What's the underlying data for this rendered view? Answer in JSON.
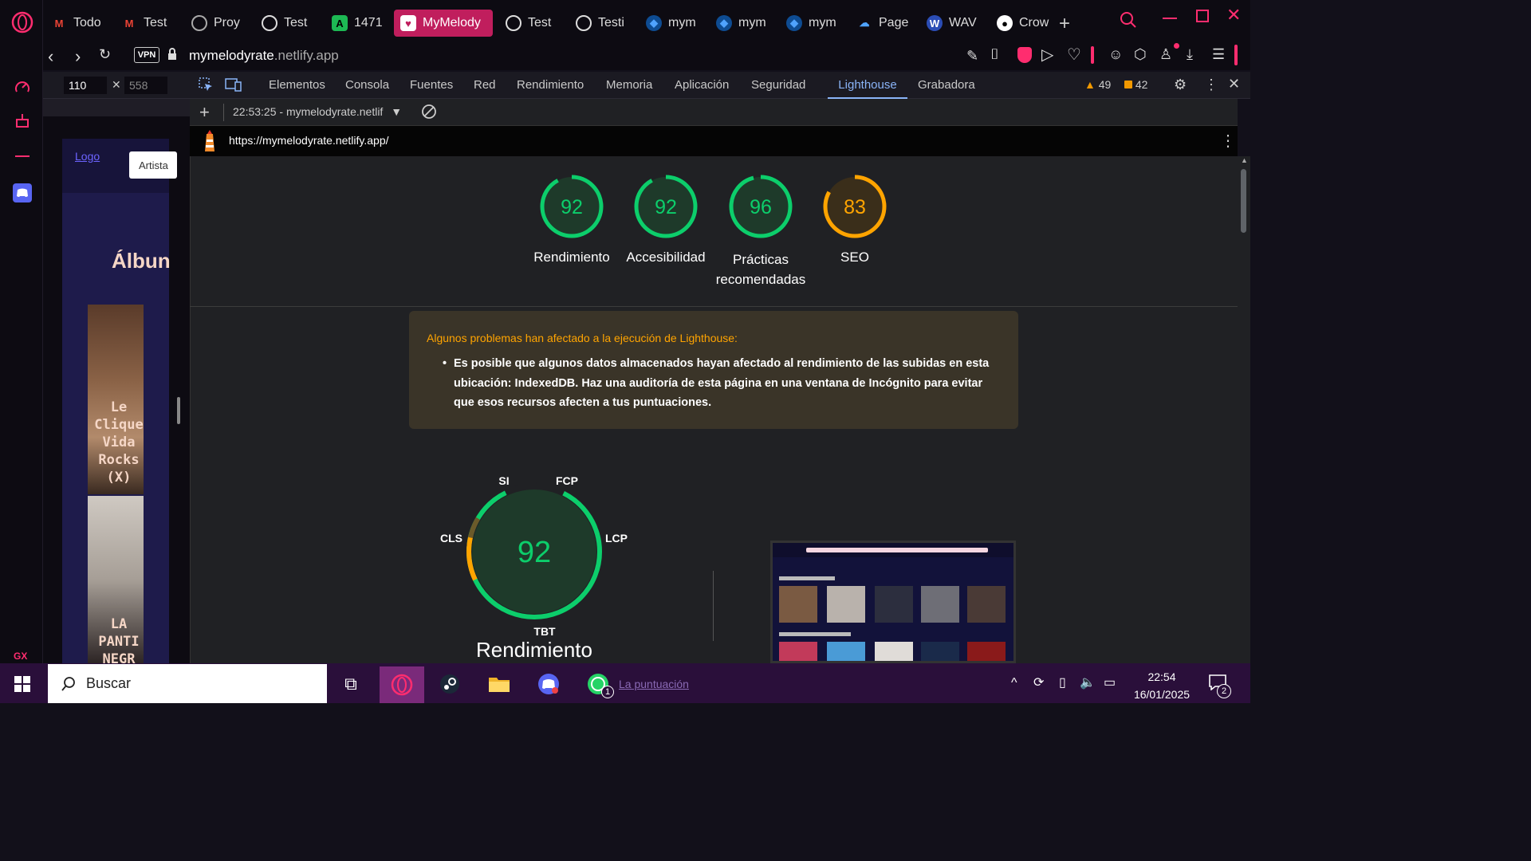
{
  "tabs": [
    {
      "label": "Todo",
      "icon": "gmail-icon"
    },
    {
      "label": "Test",
      "icon": "gmail-icon"
    },
    {
      "label": "Proy",
      "icon": "openai-icon"
    },
    {
      "label": "Test",
      "icon": "chatgpt-icon"
    },
    {
      "label": "1471",
      "icon": "a-icon"
    },
    {
      "label": "MyMelody",
      "icon": "mymelody-icon",
      "active": true
    },
    {
      "label": "Test",
      "icon": "chatgpt-icon"
    },
    {
      "label": "Testi",
      "icon": "openai-icon"
    },
    {
      "label": "mym",
      "icon": "netlify-icon"
    },
    {
      "label": "mym",
      "icon": "netlify-icon"
    },
    {
      "label": "mym",
      "icon": "netlify-icon"
    },
    {
      "label": "Page",
      "icon": "pages-icon"
    },
    {
      "label": "WAV",
      "icon": "wave-icon"
    },
    {
      "label": "Crow",
      "icon": "github-icon"
    }
  ],
  "address": {
    "vpn": "VPN",
    "url_host": "mymelodyrate",
    "url_rest": ".netlify.app"
  },
  "device": {
    "width": "110",
    "height": "558"
  },
  "devtools": {
    "tabs": [
      "Elementos",
      "Consola",
      "Fuentes",
      "Red",
      "Rendimiento",
      "Memoria",
      "Aplicación",
      "Seguridad",
      "Lighthouse",
      "Grabadora"
    ],
    "active_tab": "Lighthouse",
    "warnings": "49",
    "errors": "42"
  },
  "lighthouse": {
    "report_selector": "22:53:25 - mymelodyrate.netlif",
    "url": "https://mymelodyrate.netlify.app/",
    "scores": [
      {
        "value": "92",
        "label": "Rendimiento",
        "color": "#0cce6b"
      },
      {
        "value": "92",
        "label": "Accesibilidad",
        "color": "#0cce6b"
      },
      {
        "value": "96",
        "label": "Prácticas recomendadas",
        "color": "#0cce6b"
      },
      {
        "value": "83",
        "label": "SEO",
        "color": "#ffa400"
      }
    ],
    "warning_title": "Algunos problemas han afectado a la ejecución de Lighthouse:",
    "warning_body": "Es posible que algunos datos almacenados hayan afectado al rendimiento de las subidas en esta ubicación: IndexedDB. Haz una auditoría de esta página en una ventana de Incógnito para evitar que esos recursos afecten a tus puntuaciones.",
    "perf_gauge": {
      "score": "92",
      "metrics": [
        "SI",
        "FCP",
        "LCP",
        "TBT",
        "CLS"
      ],
      "title": "Rendimiento"
    },
    "partial_footer_text": "La puntuación"
  },
  "preview": {
    "logo_alt": "Logo",
    "artist_button": "Artista",
    "section_title": "Álbun",
    "album1": "Le Clique Vida Rocks (X)",
    "album2": "LA PANTI NEGR"
  },
  "taskbar": {
    "search_placeholder": "Buscar",
    "time": "22:54",
    "date": "16/01/2025",
    "notif_count": "2",
    "whatsapp_badge": "1"
  }
}
